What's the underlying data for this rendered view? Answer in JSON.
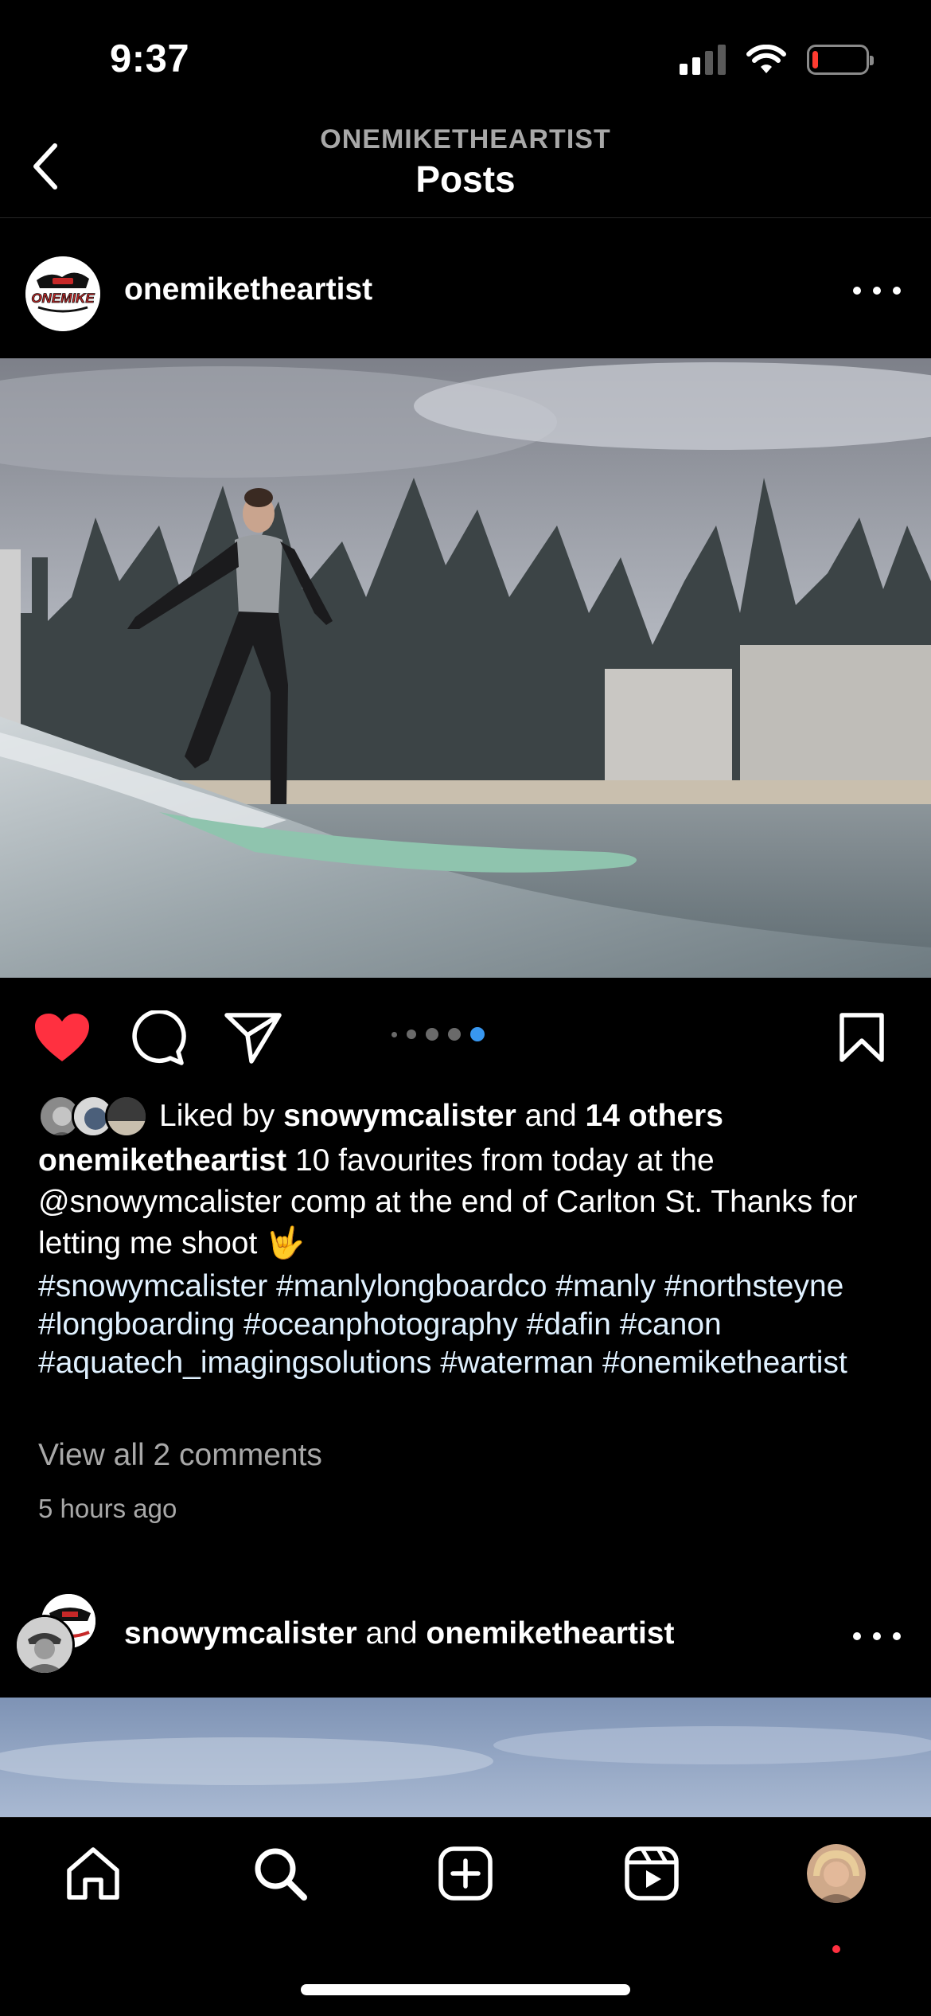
{
  "status_bar": {
    "time": "9:37",
    "signal_bars": 2,
    "signal_total": 4,
    "battery_level": 0.1,
    "battery_color": "#ff3b30"
  },
  "nav": {
    "subtitle": "ONEMIKETHEARTIST",
    "title": "Posts",
    "back_icon": "chevron-left-icon"
  },
  "post": {
    "username": "onemiketheartist",
    "avatar_text": "ONEMIKE",
    "more_icon": "more-horizontal-icon",
    "carousel": {
      "total": 4,
      "active": 4
    },
    "liked": {
      "prefix": "Liked by ",
      "user": "snowymcalister",
      "middle": " and ",
      "others": "14 others"
    },
    "caption_user": "onemiketheartist",
    "caption_text": " 10 favourites from today at the @snowymcalister comp at the end of Carlton St. Thanks for letting me shoot 🤟",
    "hashtags": "#snowymcalister #manlylongboardco #manly #northsteyne #longboarding #oceanphotography #dafin #canon #aquatech_imagingsolutions #waterman #onemiketheartist",
    "view_comments": "View all 2 comments",
    "time_ago": "5 hours ago",
    "liked_color": "#ff3040",
    "dot_active_color": "#3897f0"
  },
  "post2": {
    "user1": "snowymcalister",
    "joiner": " and ",
    "user2": "onemiketheartist"
  },
  "tab_bar": {
    "items": [
      "home-icon",
      "search-icon",
      "create-icon",
      "reels-icon",
      "profile-avatar"
    ]
  }
}
